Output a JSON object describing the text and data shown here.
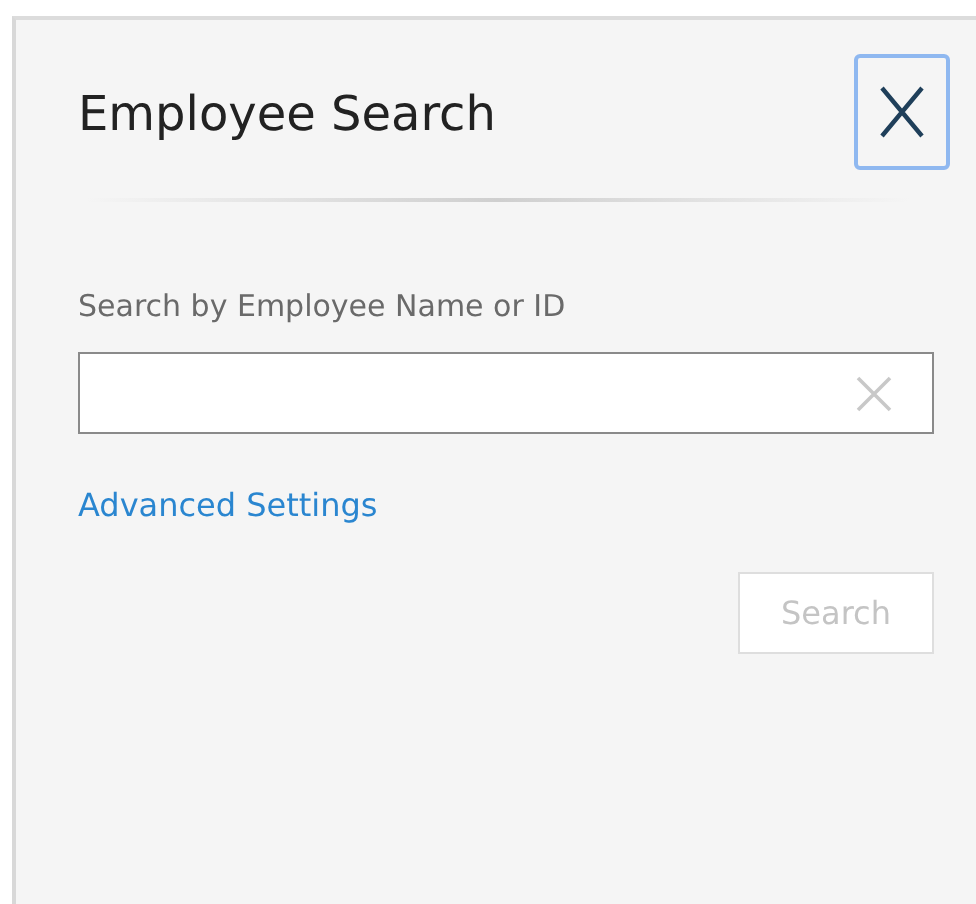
{
  "dialog": {
    "title": "Employee Search"
  },
  "search": {
    "label": "Search by Employee Name or ID"
  },
  "advanced_link": "Advanced Settings",
  "search_button": {
    "label": "Search",
    "disabled": true
  }
}
